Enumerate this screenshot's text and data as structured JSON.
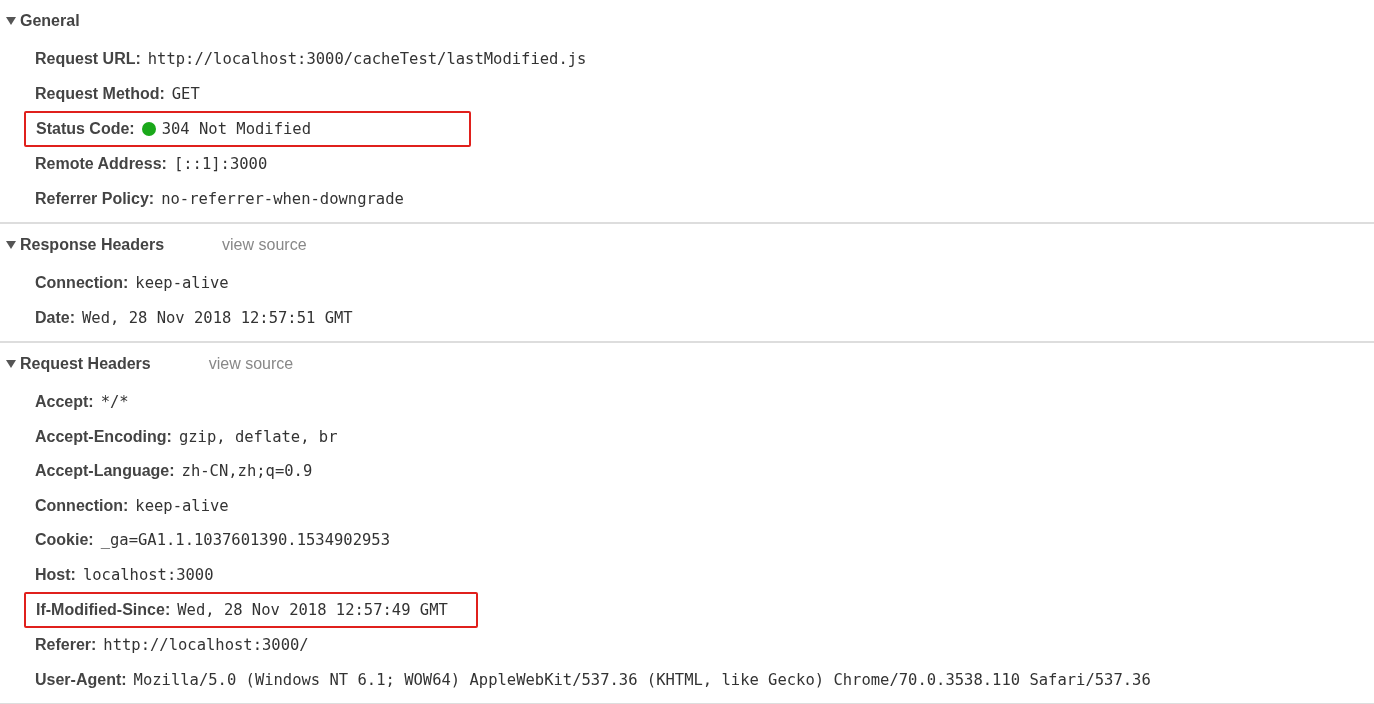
{
  "sections": [
    {
      "title": "General",
      "expanded": true,
      "rows": [
        {
          "name": "Request URL:",
          "value": "http://localhost:3000/cacheTest/lastModified.js",
          "highlighted": false
        },
        {
          "name": "Request Method:",
          "value": "GET",
          "highlighted": false
        },
        {
          "name": "Status Code:",
          "value": "304 Not Modified",
          "highlighted": true,
          "color": "#1aa81a"
        },
        {
          "name": "Remote Address:",
          "value": "[::1]:3000",
          "highlighted": false
        },
        {
          "name": "Referrer Policy:",
          "value": "no-referrer-when-downgrade",
          "highlighted": false
        }
      ]
    },
    {
      "title": "Response Headers",
      "link": "view source",
      "expanded": true,
      "rows": [
        {
          "name": "Connection:",
          "value": "keep-alive",
          "highlighted": false
        },
        {
          "name": "Date:",
          "value": "Wed, 28 Nov 2018 12:57:51 GMT",
          "highlighted": false
        }
      ]
    },
    {
      "title": "Request Headers",
      "link": "view source",
      "expanded": true,
      "rows": [
        {
          "name": "Accept:",
          "value": "*/*",
          "highlighted": false
        },
        {
          "name": "Accept-Encoding:",
          "value": "gzip, deflate, br",
          "highlighted": false
        },
        {
          "name": "Accept-Language:",
          "value": "zh-CN,zh;q=0.9",
          "highlighted": false
        },
        {
          "name": "Connection:",
          "value": "keep-alive",
          "highlighted": false
        },
        {
          "name": "Cookie:",
          "value": "_ga=GA1.1.1037601390.1534902953",
          "highlighted": false
        },
        {
          "name": "Host:",
          "value": "localhost:3000",
          "highlighted": false
        },
        {
          "name": "If-Modified-Since:",
          "value": "Wed, 28 Nov 2018 12:57:49 GMT",
          "highlighted": true
        },
        {
          "name": "Referer:",
          "value": "http://localhost:3000/",
          "highlighted": false
        },
        {
          "name": "User-Agent:",
          "value": "Mozilla/5.0 (Windows NT 6.1; WOW64) AppleWebKit/537.36 (KHTML, like Gecko) Chrome/70.0.3538.110 Safari/537.36",
          "highlighted": false
        }
      ]
    }
  ]
}
